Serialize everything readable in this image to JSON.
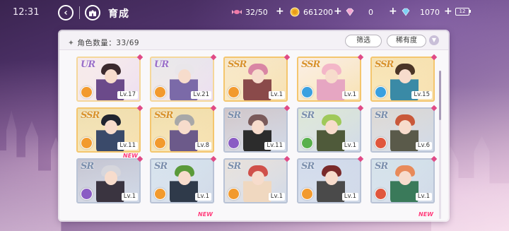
{
  "status": {
    "time": "12:31",
    "battery": "12"
  },
  "header": {
    "title": "育成"
  },
  "resources": [
    {
      "name": "candy",
      "icon": "candy-icon",
      "value": "32/50"
    },
    {
      "name": "coin",
      "icon": "coin-icon",
      "value": "661200"
    },
    {
      "name": "diamond-pink",
      "icon": "pink-diamond-icon",
      "value": "0"
    },
    {
      "name": "diamond-blue",
      "icon": "blue-diamond-icon",
      "value": "1070"
    }
  ],
  "panel": {
    "count_label": "角色数量：33/69",
    "filter_label": "筛选",
    "rarity_label": "稀有度"
  },
  "colors": {
    "elem_red": "#e0563d",
    "elem_orange": "#f29a2e",
    "elem_blue": "#3aa0e0",
    "elem_green": "#58b04c",
    "elem_purple": "#8a5cc4"
  },
  "cards": [
    {
      "rarity": "UR",
      "level": "Lv.17",
      "element": "orange",
      "hair": "#3b2a2e",
      "outfit": "#6b4a8a",
      "bg": "#f3e6f3"
    },
    {
      "rarity": "UR",
      "level": "Lv.21",
      "element": "orange",
      "hair": "#e9e6ea",
      "outfit": "#7b6aa8",
      "bg": "#dfe3f1"
    },
    {
      "rarity": "SSR",
      "level": "Lv.1",
      "element": "orange",
      "hair": "#d986a4",
      "outfit": "#8a4a4a",
      "bg": "#f2e2c8"
    },
    {
      "rarity": "SSR",
      "level": "Lv.1",
      "element": "blue",
      "hair": "#f3b6c8",
      "outfit": "#e6a6c2",
      "bg": "#f7ecf0"
    },
    {
      "rarity": "SSR",
      "level": "Lv.15",
      "element": "blue",
      "hair": "#4a3526",
      "outfit": "#3a8aa6",
      "bg": "#f2dca8"
    },
    {
      "rarity": "SSR",
      "level": "Lv.11",
      "element": "orange",
      "hair": "#1f2430",
      "outfit": "#3a4a6a",
      "bg": "#e6d6a4"
    },
    {
      "rarity": "SSR",
      "level": "Lv.8",
      "element": "orange",
      "hair": "#a8a8a8",
      "outfit": "#6c5a8a",
      "bg": "#e9d6a0"
    },
    {
      "rarity": "SR",
      "level": "Lv.11",
      "element": "purple",
      "hair": "#7a5a5a",
      "outfit": "#2c2c2c",
      "bg": "#c7b6b6"
    },
    {
      "rarity": "SR",
      "level": "Lv.1",
      "element": "green",
      "hair": "#9fc95a",
      "outfit": "#4f5a3a",
      "bg": "#d9e6c8"
    },
    {
      "rarity": "SR",
      "level": "Lv.6",
      "element": "red",
      "hair": "#c9583a",
      "outfit": "#5a5a4a",
      "bg": "#d8d0c4"
    },
    {
      "rarity": "SR",
      "level": "Lv.1",
      "element": "purple",
      "hair": "#d6d6dc",
      "outfit": "#3a3440",
      "bg": "#b6b4c2",
      "new": "NEW"
    },
    {
      "rarity": "SR",
      "level": "Lv.1",
      "element": "orange",
      "hair": "#5a9a3a",
      "outfit": "#2f3a4a",
      "bg": "#cfe0ea"
    },
    {
      "rarity": "SR",
      "level": "Lv.1",
      "element": "orange",
      "hair": "#d0504a",
      "outfit": "#f0d8c0",
      "bg": "#e9ddd0"
    },
    {
      "rarity": "SR",
      "level": "Lv.1",
      "element": "orange",
      "hair": "#7a2a2a",
      "outfit": "#4a4a4a",
      "bg": "#c8d4e8"
    },
    {
      "rarity": "SR",
      "level": "Lv.1",
      "element": "red",
      "hair": "#e88a5a",
      "outfit": "#3a7a5a",
      "bg": "#ccdfe6"
    }
  ],
  "below_badges": [
    "NEW",
    "NEW"
  ]
}
